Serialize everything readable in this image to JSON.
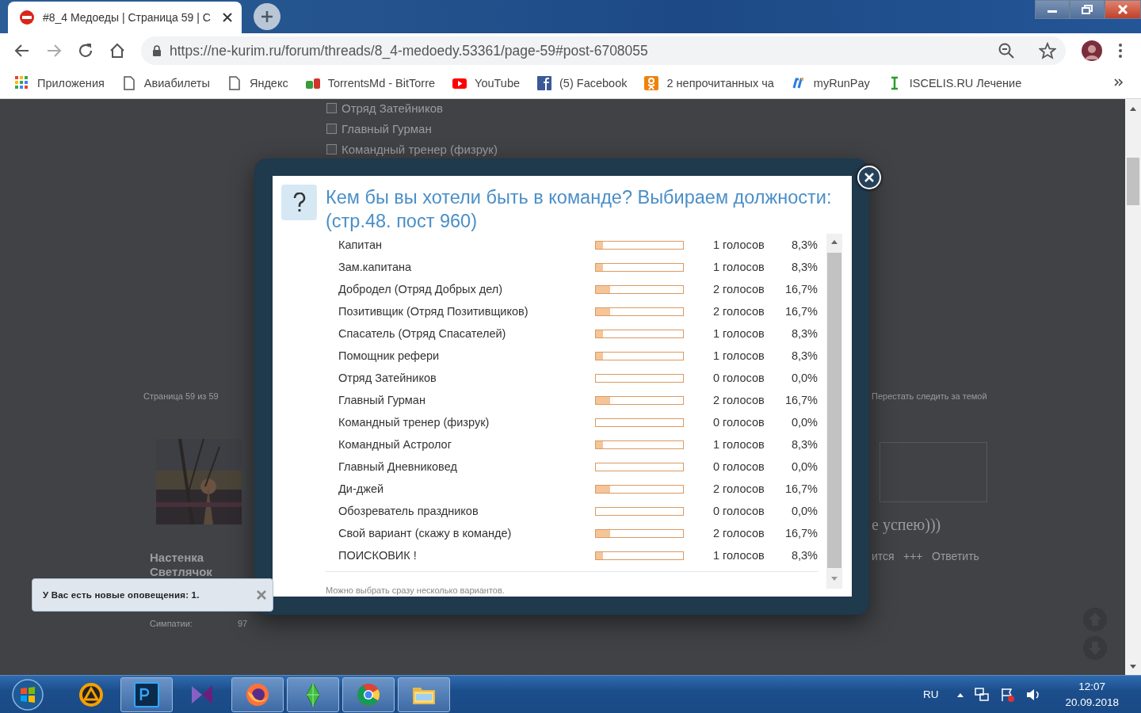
{
  "browser": {
    "tab": {
      "title": "#8_4 Медоеды | Страница 59 | С"
    },
    "address": "https://ne-kurim.ru/forum/threads/8_4-medoedy.53361/page-59#post-6708055",
    "bookmarks": [
      {
        "kind": "apps",
        "label": "Приложения"
      },
      {
        "kind": "page",
        "label": "Авиабилеты"
      },
      {
        "kind": "page",
        "label": "Яндекс"
      },
      {
        "kind": "md",
        "label": "TorrentsMd - BitTorre"
      },
      {
        "kind": "youtube",
        "label": "YouTube"
      },
      {
        "kind": "facebook",
        "label": "(5) Facebook"
      },
      {
        "kind": "ok",
        "label": "2 непрочитанных ча"
      },
      {
        "kind": "rp",
        "label": "myRunPay"
      },
      {
        "kind": "ibeam",
        "label": "ISCELIS.RU Лечение"
      }
    ]
  },
  "page": {
    "background_options": [
      {
        "label": "Отряд Затейников",
        "checked": false
      },
      {
        "label": "Главный Гурман",
        "checked": false
      },
      {
        "label": "Командный тренер (физрук)",
        "checked": false
      }
    ],
    "pagination": "Страница 59 из 59",
    "unwatch": "Перестать следить за темой",
    "author": "Настенка Светлячок",
    "likes_label": "Симпатии:",
    "likes_value": "97",
    "post_text": "е успею)))",
    "post_actions": [
      "ится",
      "+++",
      "Ответить"
    ]
  },
  "poll": {
    "title": "Кем бы вы хотели быть в команде? Выбираем должности: (стр.48. пост 960)",
    "options": [
      {
        "label": "Капитан",
        "votes": "1 голосов",
        "percent": "8,3%",
        "level": 0.083
      },
      {
        "label": "Зам.капитана",
        "votes": "1 голосов",
        "percent": "8,3%",
        "level": 0.083
      },
      {
        "label": "Добродел (Отряд Добрых дел)",
        "votes": "2 голосов",
        "percent": "16,7%",
        "level": 0.167
      },
      {
        "label": "Позитивщик (Отряд Позитивщиков)",
        "votes": "2 голосов",
        "percent": "16,7%",
        "level": 0.167
      },
      {
        "label": "Спасатель (Отряд Спасателей)",
        "votes": "1 голосов",
        "percent": "8,3%",
        "level": 0.083
      },
      {
        "label": "Помощник рефери",
        "votes": "1 голосов",
        "percent": "8,3%",
        "level": 0.083
      },
      {
        "label": "Отряд Затейников",
        "votes": "0 голосов",
        "percent": "0,0%",
        "level": 0
      },
      {
        "label": "Главный Гурман",
        "votes": "2 голосов",
        "percent": "16,7%",
        "level": 0.167
      },
      {
        "label": "Командный тренер (физрук)",
        "votes": "0 голосов",
        "percent": "0,0%",
        "level": 0
      },
      {
        "label": "Командный Астролог",
        "votes": "1 голосов",
        "percent": "8,3%",
        "level": 0.083
      },
      {
        "label": "Главный Дневниковед",
        "votes": "0 голосов",
        "percent": "0,0%",
        "level": 0
      },
      {
        "label": "Ди-джей",
        "votes": "2 голосов",
        "percent": "16,7%",
        "level": 0.167
      },
      {
        "label": "Обозреватель праздников",
        "votes": "0 голосов",
        "percent": "0,0%",
        "level": 0
      },
      {
        "label": "Свой вариант (скажу в команде)",
        "votes": "2 голосов",
        "percent": "16,7%",
        "level": 0.167
      },
      {
        "label": "ПОИСКОВИК !",
        "votes": "1 голосов",
        "percent": "8,3%",
        "level": 0.083
      }
    ],
    "note": "Можно выбрать сразу несколько вариантов."
  },
  "notification": {
    "text": "У Вас есть новые оповещения: 1."
  },
  "taskbar": {
    "apps": [
      {
        "kind": "aimp",
        "running": false
      },
      {
        "kind": "photoshop",
        "running": true
      },
      {
        "kind": "studio",
        "running": false
      },
      {
        "kind": "firefox",
        "running": true
      },
      {
        "kind": "sims",
        "running": true
      },
      {
        "kind": "chrome",
        "running": true
      },
      {
        "kind": "folder",
        "running": true
      }
    ],
    "language": "RU",
    "time": "12:07",
    "date": "20.09.2018"
  }
}
